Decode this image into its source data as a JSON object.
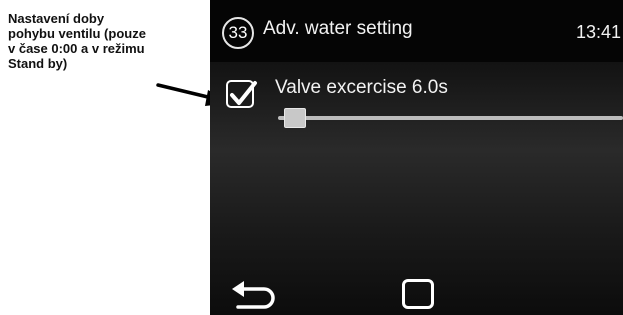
{
  "annotation": {
    "text": "Nastavení doby\npohybu ventilu (pouze\nv čase 0:00 a v režimu\nStand by)"
  },
  "screen": {
    "page_number": "33",
    "title": "Adv. water setting",
    "clock": "13:41",
    "setting": {
      "checked": true,
      "label": "Valve excercise 6.0s",
      "slider_fraction": 0.02
    },
    "nav": {
      "back_icon": "back-arrow-icon",
      "home_icon": "square-home-icon"
    }
  }
}
